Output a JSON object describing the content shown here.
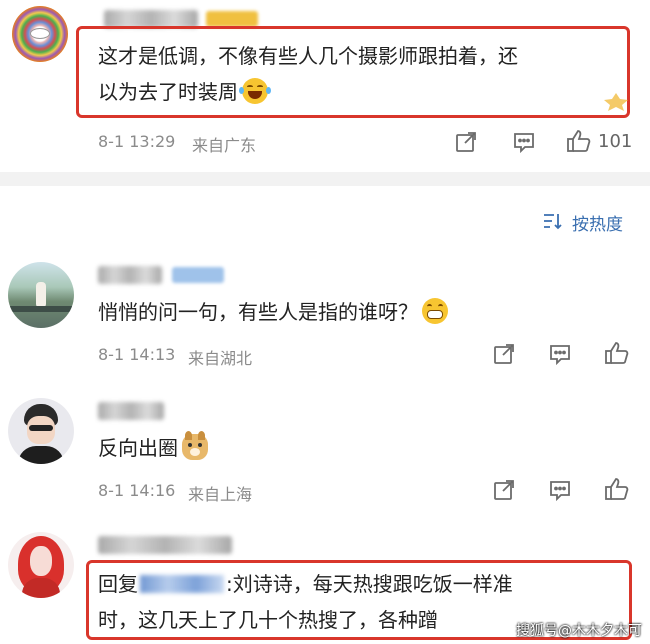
{
  "comments": [
    {
      "text": "这才是低调，不像有些人几个摄影师跟拍着，还",
      "text_line2": "以为去了时装周",
      "time": "8-1 13:29",
      "location": "来自广东",
      "like_count": "101"
    },
    {
      "text": "悄悄的问一句，有些人是指的谁呀？",
      "time": "8-1 14:13",
      "location": "来自湖北"
    },
    {
      "text": "反向出圈",
      "time": "8-1 14:16",
      "location": "来自上海"
    },
    {
      "reply_prefix": "回复",
      "reply_suffix": ":刘诗诗，每天热搜跟吃饭一样准",
      "text_line2": "时，这几天上了几十个热搜了，各种蹭"
    }
  ],
  "sort": {
    "label": "按热度",
    "icon": "sort-icon"
  },
  "watermark": "搜狐号@木木夕木可",
  "colors": {
    "highlight": "#d9362b",
    "link": "#3a6fb0",
    "meta": "#8b8b8b"
  }
}
